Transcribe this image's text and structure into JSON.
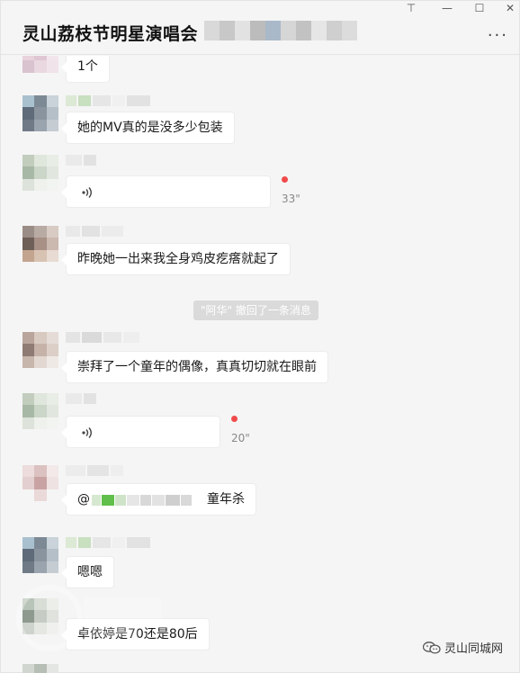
{
  "window": {
    "title": "灵山荔枝节明星演唱会",
    "minimize_glyph": "—",
    "maximize_glyph": "☐",
    "close_glyph": "✕",
    "pin_glyph": "⊤",
    "more_glyph": "···"
  },
  "messages": [
    {
      "type": "text",
      "text": "1个"
    },
    {
      "type": "text",
      "text": "她的MV真的是没多少包装"
    },
    {
      "type": "voice",
      "duration": "33\"",
      "unread": true
    },
    {
      "type": "text",
      "text": "昨晚她一出来我全身鸡皮疙瘩就起了"
    },
    {
      "type": "system",
      "text": "\"阿华\" 撤回了一条消息"
    },
    {
      "type": "text",
      "text": "崇拜了一个童年的偶像，真真切切就在眼前"
    },
    {
      "type": "voice",
      "duration": "20\"",
      "unread": true
    },
    {
      "type": "mention",
      "prefix": "@",
      "text": "童年杀"
    },
    {
      "type": "text",
      "text": "嗯嗯"
    },
    {
      "type": "text",
      "text": "卓依婷是70还是80后"
    }
  ],
  "branding": {
    "label": "灵山同城网"
  },
  "colors": {
    "background": "#f5f5f5",
    "bubble": "#ffffff",
    "unread_dot": "#f04a4a",
    "system_note_bg": "#dadada"
  }
}
